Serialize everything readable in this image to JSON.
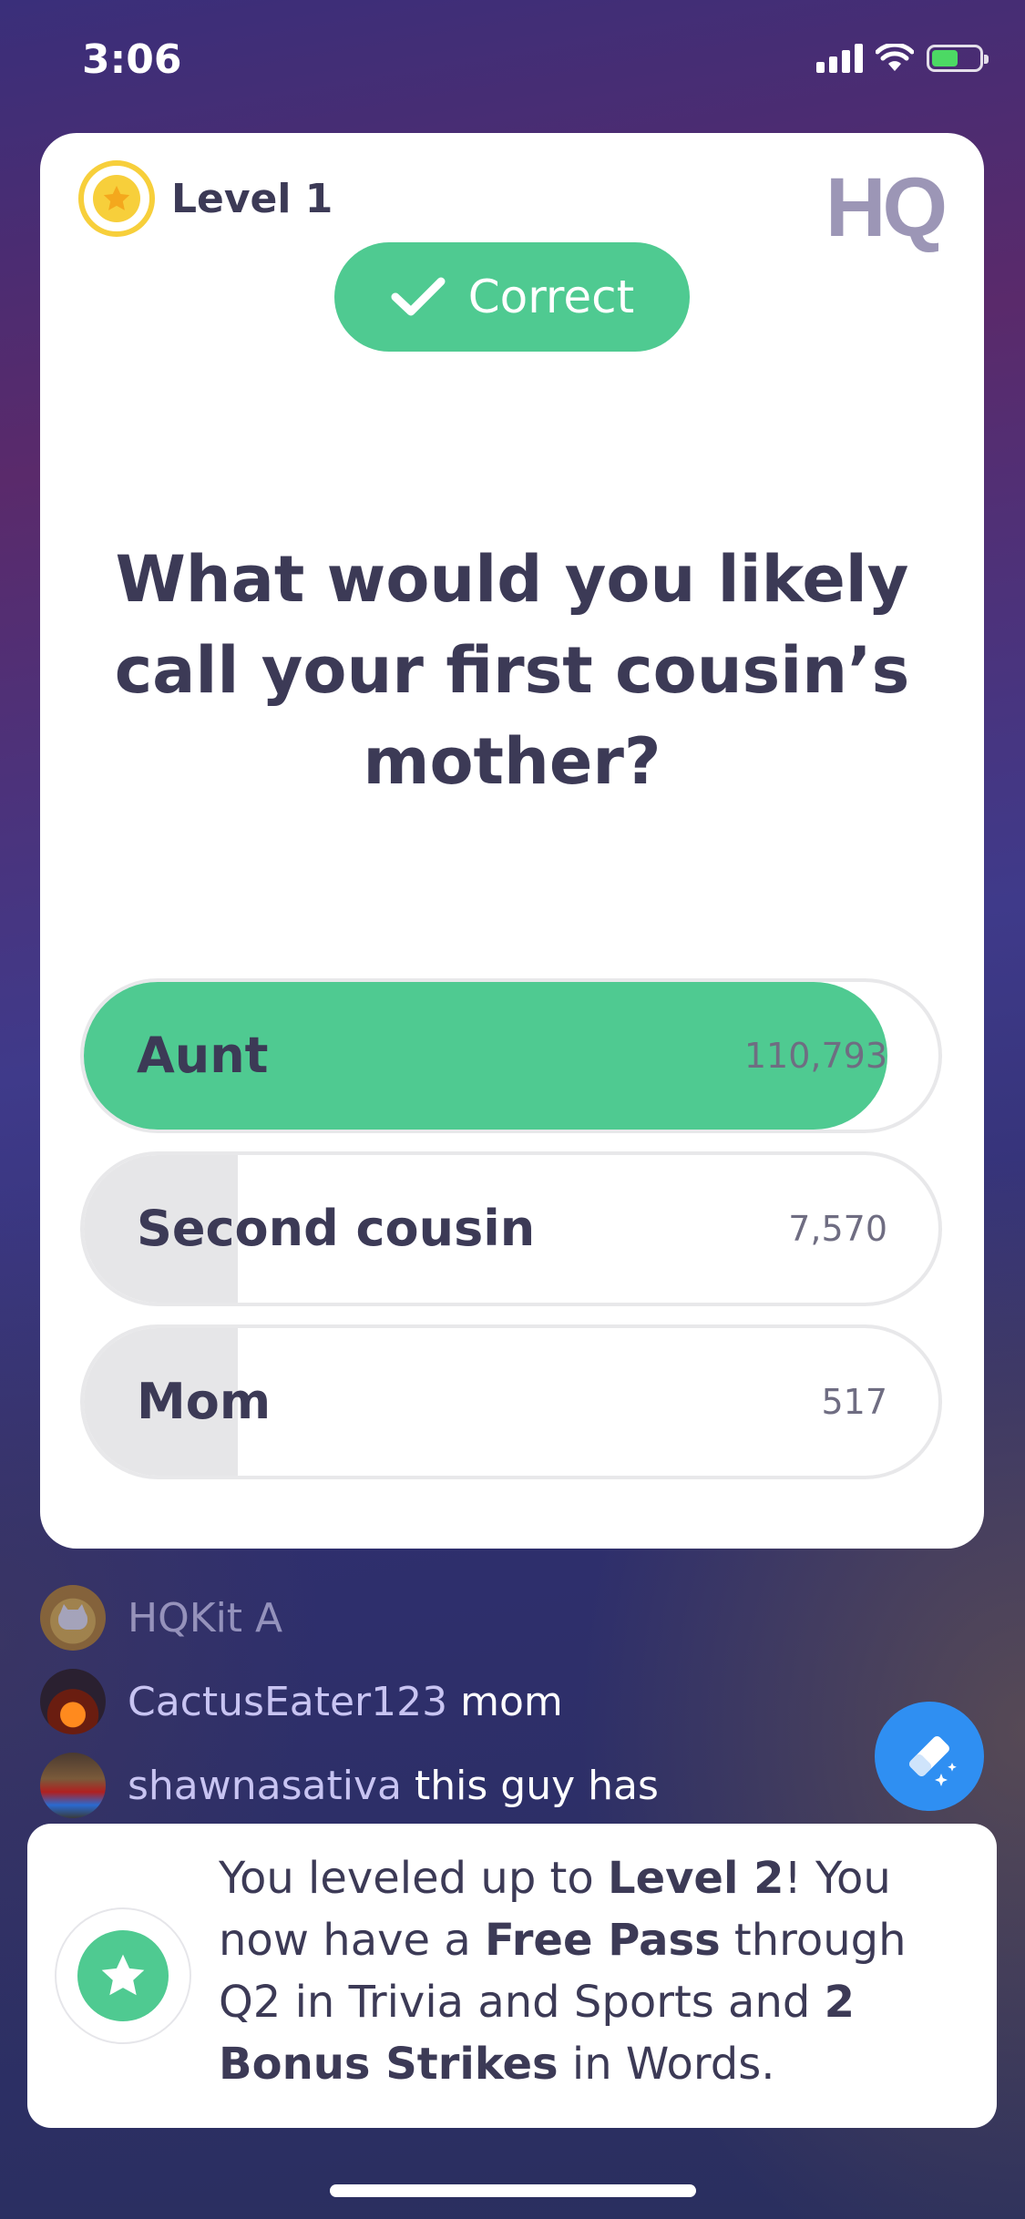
{
  "status_bar": {
    "time": "3:06",
    "icons": [
      "signal-icon",
      "wifi-icon",
      "battery-charging-icon"
    ]
  },
  "card": {
    "level_label": "Level 1",
    "logo": "HQ",
    "result_label": "Correct",
    "question": "What would you likely call your first cousin’s mother?",
    "answers": [
      {
        "label": "Aunt",
        "count": "110,793",
        "share": 0.94,
        "correct": true
      },
      {
        "label": "Second cousin",
        "count": "7,570",
        "share": 0.18,
        "correct": false
      },
      {
        "label": "Mom",
        "count": "517",
        "share": 0.18,
        "correct": false
      }
    ]
  },
  "chat": [
    {
      "user": "HQKit A",
      "message": ""
    },
    {
      "user": "CactusEater123",
      "message": "mom"
    },
    {
      "user": "shawnasativa",
      "message": "this guy has"
    }
  ],
  "toast": {
    "t1": "You leveled up to ",
    "b1": "Level 2",
    "t2": "! You now have a ",
    "b2": "Free Pass",
    "t3": " through Q2 in Trivia and Sports and ",
    "b3": "2 Bonus Strikes",
    "t4": " in Words."
  },
  "colors": {
    "correct_green": "#4fca91",
    "level_gold": "#f7cf3b",
    "eraser_blue": "#2f8ff2"
  }
}
